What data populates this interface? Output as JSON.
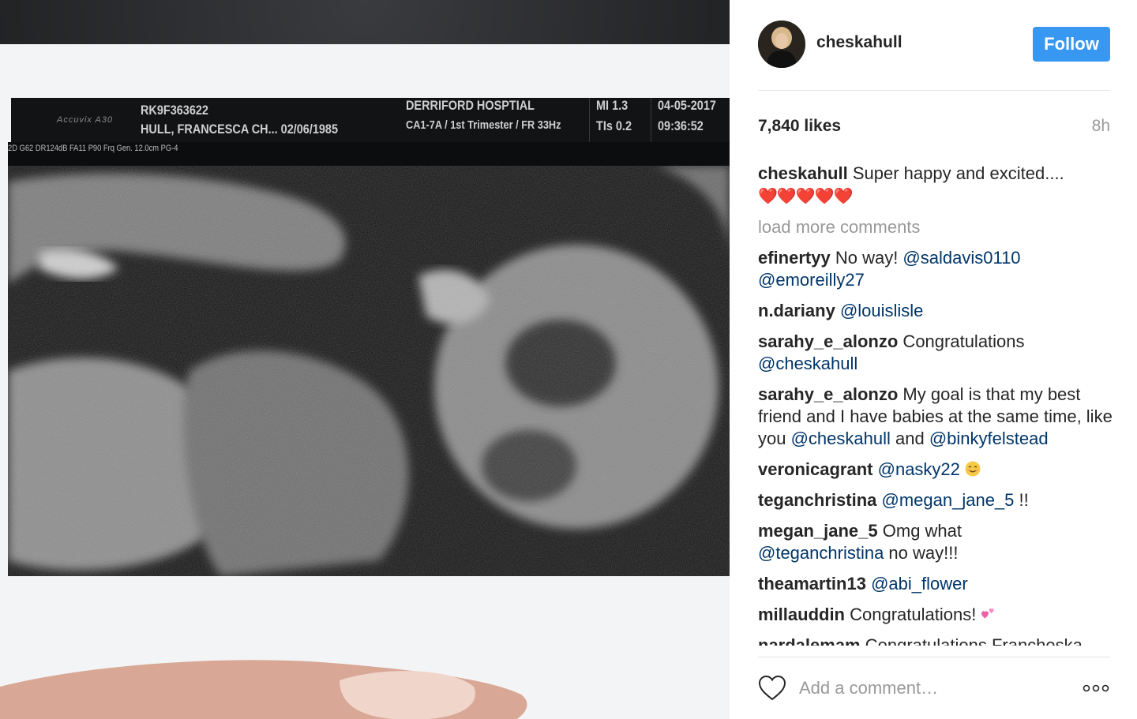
{
  "photo": {
    "scan_header": {
      "logo": "Accuvix A30",
      "patient_id": "RK9F363622",
      "patient_name": "HULL, FRANCESCA CH... 02/06/1985",
      "hospital": "DERRIFORD HOSPTIAL",
      "exam": "CA1-7A / 1st Trimester / FR 33Hz",
      "mi": "MI  1.3",
      "tis": "TIs 0.2",
      "date": "04-05-2017",
      "time": "09:36:52",
      "params": "2D G62 DR124dB FA11 P90 Frq Gen. 12.0cm PG-4"
    }
  },
  "post": {
    "username": "cheskahull",
    "follow_label": "Follow",
    "likes": "7,840 likes",
    "age": "8h",
    "caption": {
      "user": "cheskahull",
      "text": " Super happy and excited....",
      "hearts": "❤️❤️❤️❤️❤️"
    },
    "load_more": "load more comments",
    "comments": [
      {
        "user": "efinertyy",
        "text": " No way! ",
        "mentions": [
          "@saldavis0110",
          "@emoreilly27"
        ]
      },
      {
        "user": "n.dariany",
        "text": " ",
        "mentions": [
          "@louislisle"
        ]
      },
      {
        "user": "sarahy_e_alonzo",
        "text": " Congratulations ",
        "mentions": [
          "@cheskahull"
        ]
      },
      {
        "user": "sarahy_e_alonzo",
        "text": " My goal is that my best friend and I have babies at the same time, like you ",
        "mentions": [
          "@cheskahull",
          "@binkyfelstead"
        ],
        "between": " and "
      },
      {
        "user": "veronicagrant",
        "text": " ",
        "mentions": [
          "@nasky22"
        ]
      },
      {
        "user": "teganchristina",
        "text": " ",
        "mentions": [
          "@megan_jane_5"
        ],
        "after": " !!"
      },
      {
        "user": "megan_jane_5",
        "text": " Omg what ",
        "mentions": [
          "@teganchristina"
        ],
        "after": " no way!!!"
      },
      {
        "user": "theamartin13",
        "text": " ",
        "mentions": [
          "@abi_flower"
        ]
      },
      {
        "user": "millauddin",
        "text": " Congratulations! "
      },
      {
        "user": "nardalemam",
        "text": " Congratulations Francheska"
      }
    ],
    "add_comment_placeholder": "Add a comment…"
  },
  "icons": {
    "like": "heart-outline-icon",
    "more": "more-options-icon"
  },
  "colors": {
    "follow_bg": "#3897f0",
    "mention": "#003569",
    "muted": "#999999"
  }
}
